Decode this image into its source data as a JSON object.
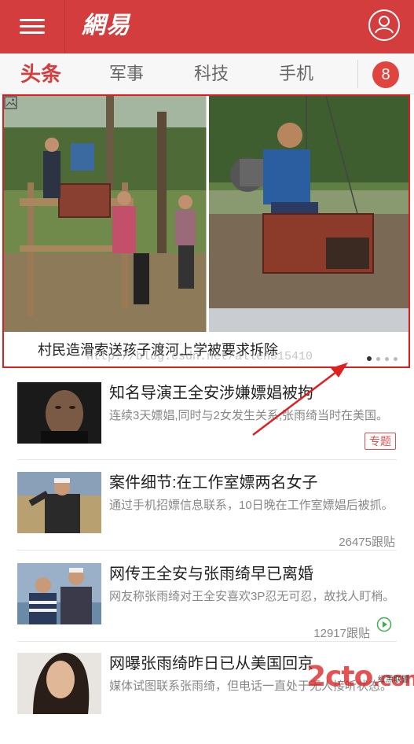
{
  "header": {
    "logo_text": "網易",
    "menu_icon": "hamburger-menu-icon",
    "user_icon": "user-profile-icon",
    "brand_color": "#d43d3d"
  },
  "tabs": {
    "items": [
      {
        "label": "头条",
        "active": true
      },
      {
        "label": "军事",
        "active": false
      },
      {
        "label": "科技",
        "active": false
      },
      {
        "label": "手机",
        "active": false
      }
    ],
    "badge_count": "8"
  },
  "carousel": {
    "caption": "村民造滑索送孩子渡河上学被要求拆除",
    "caption_icon": "image-gallery-icon",
    "slide_count": 4,
    "active_slide": 1
  },
  "watermark": "http://blog.csdn.net/allen315410",
  "news": [
    {
      "title": "知名导演王全安涉嫌嫖娼被拘",
      "digest": "连续3天嫖娼,同时与2女发生关系;张雨绮当时在美国。",
      "meta": "",
      "tag": "专题"
    },
    {
      "title": "案件细节:在工作室嫖两名女子",
      "digest": "通过手机招嫖信息联系，10日晚在工作室嫖娼后被抓。",
      "meta": "26475跟贴",
      "tag": ""
    },
    {
      "title": "网传王全安与张雨绮早已离婚",
      "digest": "网友称张雨绮对王全安喜欢3P忍无可忍，故找人盯梢。",
      "meta": "12917跟贴",
      "tag": ""
    },
    {
      "title": "网曝张雨绮昨日已从美国回京",
      "digest": "媒体试图联系张雨绮，但电话一直处于无人接听状态。",
      "meta": "",
      "tag": ""
    }
  ],
  "corner_logo": {
    "main": "2cto",
    "suffix": ".com",
    "sub": "红黑联盟"
  }
}
